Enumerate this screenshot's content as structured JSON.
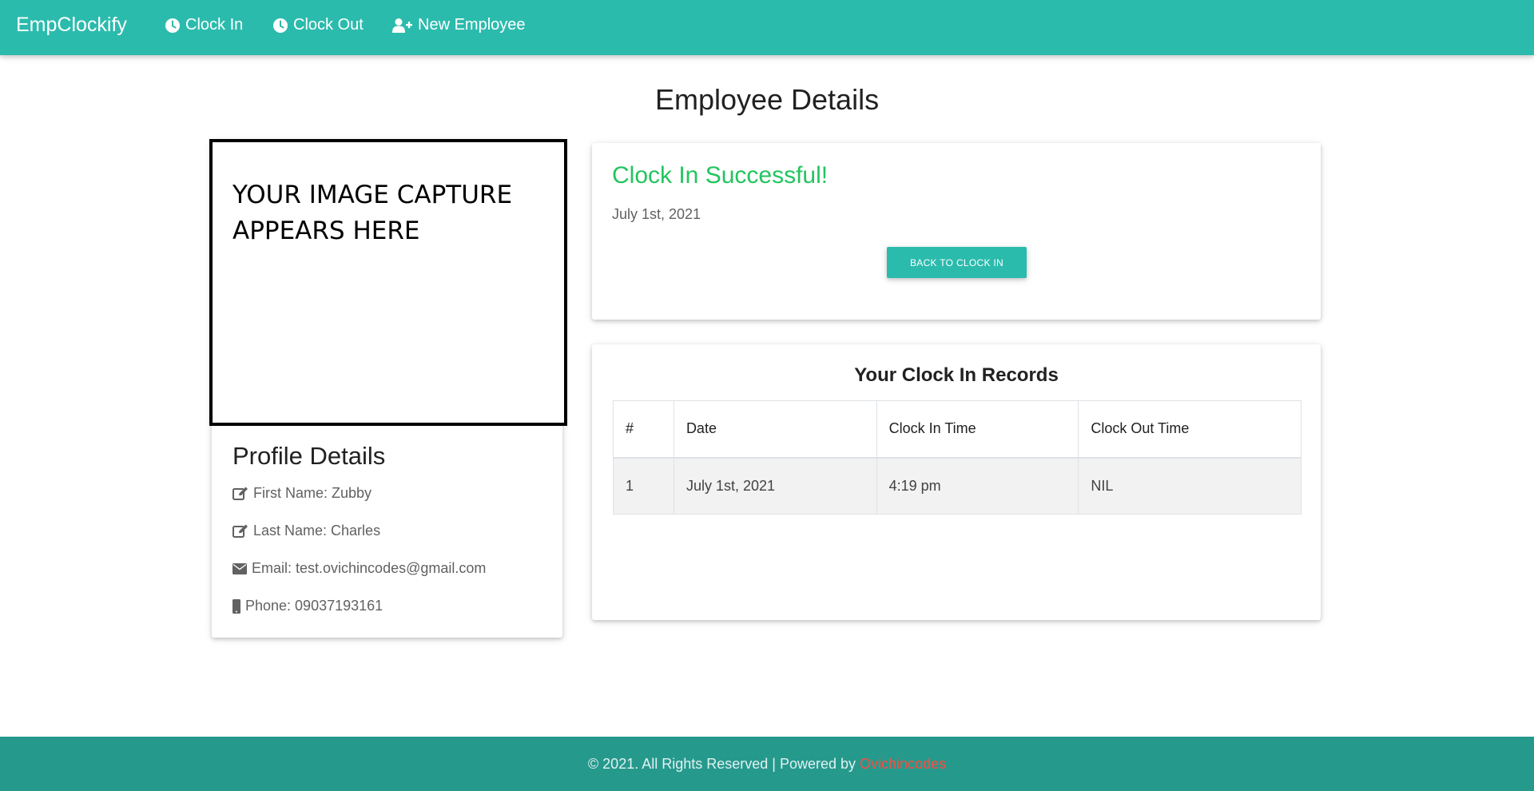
{
  "navbar": {
    "brand": "EmpClockify",
    "links": [
      {
        "label": "Clock In",
        "icon": "clock-icon"
      },
      {
        "label": "Clock Out",
        "icon": "clock-icon"
      },
      {
        "label": "New Employee",
        "icon": "user-plus-icon"
      }
    ]
  },
  "page": {
    "title": "Employee Details"
  },
  "profile": {
    "capture_text": "YOUR IMAGE CAPTURE APPEARS HERE",
    "title": "Profile Details",
    "first_name": "First Name: Zubby",
    "last_name": "Last Name: Charles",
    "email": "Email: test.ovichincodes@gmail.com",
    "phone": "Phone: 09037193161"
  },
  "status": {
    "title": "Clock In Successful!",
    "date": "July 1st, 2021",
    "button_label": "BACK TO CLOCK IN",
    "title_color": "#22c55e"
  },
  "records": {
    "title": "Your Clock In Records",
    "columns": [
      "#",
      "Date",
      "Clock In Time",
      "Clock Out Time"
    ],
    "rows": [
      [
        "1",
        "July 1st, 2021",
        "4:19 pm",
        "NIL"
      ]
    ]
  },
  "footer": {
    "text": "© 2021. All Rights Reserved | Powered by",
    "link": "Ovichincodes"
  },
  "colors": {
    "accent": "#2bbbad",
    "footer_bg": "#26998d",
    "footer_link": "#ff4b3e"
  }
}
